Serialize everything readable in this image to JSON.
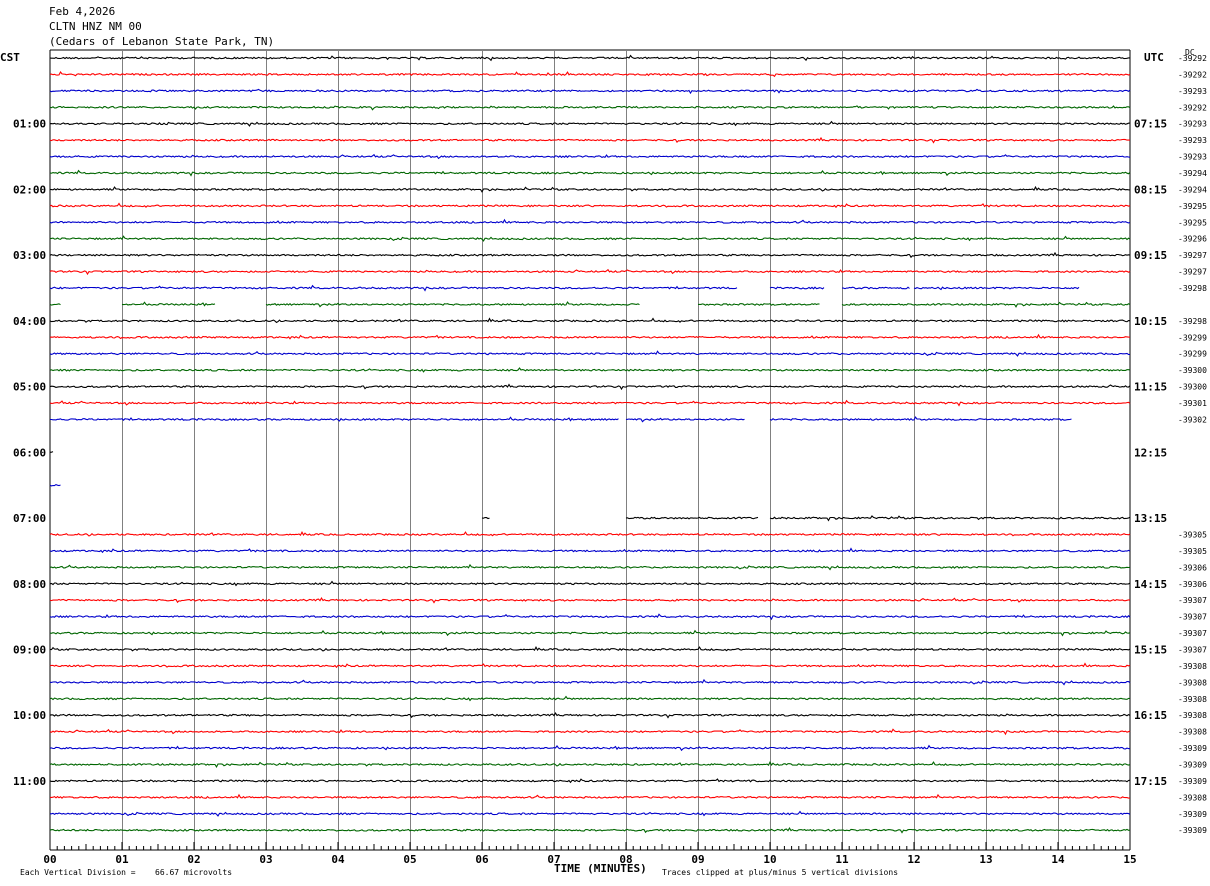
{
  "header": {
    "date": "Feb 4,2026",
    "station": "CLTN HNZ NM 00",
    "location": "(Cedars of Lebanon State Park, TN)"
  },
  "left_timezone": "CST",
  "right_timezone": "UTC",
  "right_top_label": "DC",
  "footer": {
    "scale_label": "Each Vertical Division =",
    "scale_value": "66.67 microvolts",
    "clip_note": "Traces clipped at plus/minus 5 vertical divisions"
  },
  "colors": {
    "trace_cycle": [
      "#000000",
      "#ff0000",
      "#0000cc",
      "#006600"
    ],
    "grid": "#808080"
  },
  "chart_data": {
    "type": "line",
    "xlabel": "TIME (MINUTES)",
    "xlim": [
      0,
      15
    ],
    "x_ticks": [
      "00",
      "01",
      "02",
      "03",
      "04",
      "05",
      "06",
      "07",
      "08",
      "09",
      "10",
      "11",
      "12",
      "13",
      "14",
      "15"
    ],
    "left_hour_labels": [
      "01:00",
      "02:00",
      "03:00",
      "04:00",
      "05:00",
      "06:00",
      "07:00",
      "08:00",
      "09:00",
      "10:00",
      "11:00"
    ],
    "right_hour_labels": [
      "07:15",
      "08:15",
      "09:15",
      "10:15",
      "11:15",
      "12:15",
      "13:15",
      "14:15",
      "15:15",
      "16:15",
      "17:15"
    ],
    "rows_per_hour": 4,
    "total_rows": 48,
    "row_dc_values": [
      "-39292",
      "-39292",
      "-39293",
      "-39292",
      "-39293",
      "-39293",
      "-39293",
      "-39294",
      "-39294",
      "-39295",
      "-39295",
      "-39296",
      "-39297",
      "-39297",
      "-39298",
      "",
      "-39298",
      "-39299",
      "-39299",
      "-39300",
      "-39300",
      "-39301",
      "-39302",
      "",
      "",
      "",
      "",
      "",
      "",
      "-39305",
      "-39305",
      "-39306",
      "-39306",
      "-39307",
      "-39307",
      "-39307",
      "-39307",
      "-39308",
      "-39308",
      "-39308",
      "-39308",
      "-39308",
      "-39309",
      "-39309",
      "-39309",
      "-39308",
      "-39309",
      "-39309"
    ],
    "segments_minutes": [
      [
        [
          0,
          15
        ]
      ],
      [
        [
          0,
          15
        ]
      ],
      [
        [
          0,
          15
        ]
      ],
      [
        [
          0,
          15
        ]
      ],
      [
        [
          0,
          15
        ]
      ],
      [
        [
          0,
          15
        ]
      ],
      [
        [
          0,
          15
        ]
      ],
      [
        [
          0,
          15
        ]
      ],
      [
        [
          0,
          15
        ]
      ],
      [
        [
          0,
          15
        ]
      ],
      [
        [
          0,
          15
        ]
      ],
      [
        [
          0,
          15
        ]
      ],
      [
        [
          0,
          15
        ]
      ],
      [
        [
          0,
          15
        ]
      ],
      [
        [
          0,
          9.55
        ],
        [
          10.0,
          10.75
        ],
        [
          11.0,
          11.95
        ],
        [
          12.0,
          14.3
        ]
      ],
      [
        [
          0,
          0.15
        ],
        [
          1.0,
          2.3
        ],
        [
          3.0,
          8.2
        ],
        [
          9.0,
          10.7
        ],
        [
          11.0,
          15
        ]
      ],
      [
        [
          0,
          15
        ]
      ],
      [
        [
          0,
          15
        ]
      ],
      [
        [
          0,
          15
        ]
      ],
      [
        [
          0,
          15
        ]
      ],
      [
        [
          0,
          15
        ]
      ],
      [
        [
          0,
          15
        ]
      ],
      [
        [
          0,
          7.9
        ],
        [
          8.0,
          9.65
        ],
        [
          10.0,
          14.2
        ]
      ],
      [],
      [
        [
          0,
          0.05
        ]
      ],
      [],
      [
        [
          0,
          0.15
        ]
      ],
      [],
      [
        [
          6.0,
          6.12
        ],
        [
          8.0,
          9.85
        ],
        [
          10.0,
          15
        ]
      ],
      [
        [
          0,
          15
        ]
      ],
      [
        [
          0,
          15
        ]
      ],
      [
        [
          0,
          15
        ]
      ],
      [
        [
          0,
          15
        ]
      ],
      [
        [
          0,
          15
        ]
      ],
      [
        [
          0,
          15
        ]
      ],
      [
        [
          0,
          15
        ]
      ],
      [
        [
          0,
          15
        ]
      ],
      [
        [
          0,
          15
        ]
      ],
      [
        [
          0,
          15
        ]
      ],
      [
        [
          0,
          15
        ]
      ],
      [
        [
          0,
          15
        ]
      ],
      [
        [
          0,
          15
        ]
      ],
      [
        [
          0,
          15
        ]
      ],
      [
        [
          0,
          15
        ]
      ],
      [
        [
          0,
          15
        ]
      ],
      [
        [
          0,
          15
        ]
      ],
      [
        [
          0,
          15
        ]
      ],
      [
        [
          0,
          15
        ]
      ]
    ],
    "grid": true
  }
}
